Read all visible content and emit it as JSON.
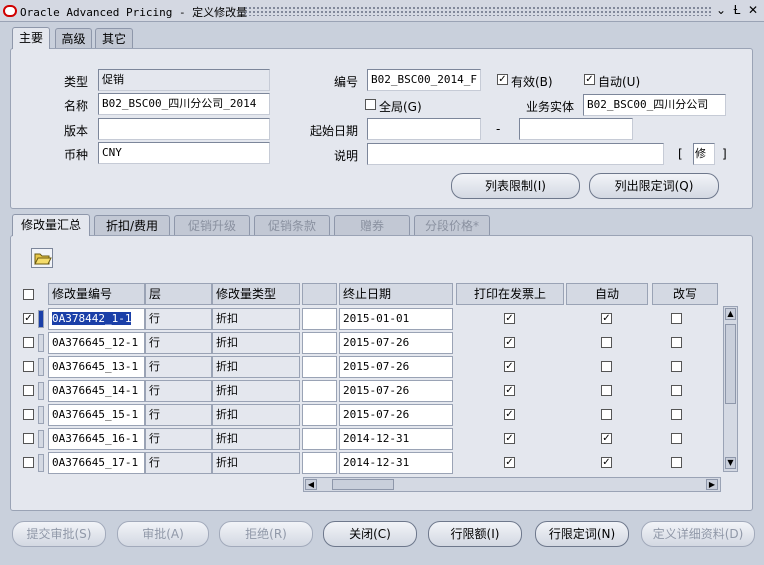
{
  "window": {
    "title": "Oracle Advanced Pricing - 定义修改量",
    "controls": [
      "⌄",
      "Ƚ",
      "✕"
    ]
  },
  "top_tabs": [
    {
      "label": "主要",
      "active": true
    },
    {
      "label": "高级",
      "active": false
    },
    {
      "label": "其它",
      "active": false
    }
  ],
  "header": {
    "type_label": "类型",
    "type_value": "促销",
    "name_label": "名称",
    "name_value": "B02_BSC00_四川分公司_2014",
    "version_label": "版本",
    "version_value": "",
    "currency_label": "币种",
    "currency_value": "CNY",
    "number_label": "编号",
    "number_value": "B02_BSC00_2014_F",
    "active_label": "有效(B)",
    "active_checked": true,
    "auto_label": "自动(U)",
    "auto_checked": true,
    "global_label": "全局(G)",
    "global_checked": false,
    "bu_label": "业务实体",
    "bu_value": "B02_BSC00_四川分公司",
    "start_label": "起始日期",
    "start_value": "",
    "end_value": "",
    "dash": "-",
    "desc_label": "说明",
    "desc_value": "",
    "bracket_open": "[",
    "bracket_close": "]",
    "flex_value": "修",
    "list_limit_btn": "列表限制(I)",
    "list_qualifier_btn": "列出限定词(Q)"
  },
  "sub_tabs": [
    {
      "label": "修改量汇总",
      "active": true,
      "enabled": true
    },
    {
      "label": "折扣/费用",
      "active": false,
      "enabled": true
    },
    {
      "label": "促销升级",
      "active": false,
      "enabled": false
    },
    {
      "label": "促销条款",
      "active": false,
      "enabled": false
    },
    {
      "label": "赠券",
      "active": false,
      "enabled": false
    },
    {
      "label": "分段价格*",
      "active": false,
      "enabled": false
    }
  ],
  "grid": {
    "headers": [
      "修改量编号",
      "层",
      "修改量类型",
      "",
      "终止日期",
      "打印在发票上",
      "自动",
      "改写"
    ],
    "rows": [
      {
        "selected": true,
        "checked": true,
        "number": "0A378442_1-1",
        "level": "行",
        "type": "折扣",
        "end_date": "2015-01-01",
        "print": true,
        "auto": true,
        "override": false
      },
      {
        "selected": false,
        "checked": false,
        "number": "0A376645_12-1",
        "level": "行",
        "type": "折扣",
        "end_date": "2015-07-26",
        "print": true,
        "auto": false,
        "override": false
      },
      {
        "selected": false,
        "checked": false,
        "number": "0A376645_13-1",
        "level": "行",
        "type": "折扣",
        "end_date": "2015-07-26",
        "print": true,
        "auto": false,
        "override": false
      },
      {
        "selected": false,
        "checked": false,
        "number": "0A376645_14-1",
        "level": "行",
        "type": "折扣",
        "end_date": "2015-07-26",
        "print": true,
        "auto": false,
        "override": false
      },
      {
        "selected": false,
        "checked": false,
        "number": "0A376645_15-1",
        "level": "行",
        "type": "折扣",
        "end_date": "2015-07-26",
        "print": true,
        "auto": false,
        "override": false
      },
      {
        "selected": false,
        "checked": false,
        "number": "0A376645_16-1",
        "level": "行",
        "type": "折扣",
        "end_date": "2014-12-31",
        "print": true,
        "auto": true,
        "override": false
      },
      {
        "selected": false,
        "checked": false,
        "number": "0A376645_17-1",
        "level": "行",
        "type": "折扣",
        "end_date": "2014-12-31",
        "print": true,
        "auto": true,
        "override": false
      }
    ]
  },
  "bottom_buttons": [
    {
      "label": "提交审批(S)",
      "enabled": false
    },
    {
      "label": "审批(A)",
      "enabled": false
    },
    {
      "label": "拒绝(R)",
      "enabled": false
    },
    {
      "label": "关闭(C)",
      "enabled": true
    },
    {
      "label": "行限额(I)",
      "enabled": true
    },
    {
      "label": "行限定词(N)",
      "enabled": true
    },
    {
      "label": "定义详细资料(D)",
      "enabled": false
    }
  ],
  "colors": {
    "selection": "#1a3fa8",
    "panel": "#e4e7ee",
    "background": "#c9d0dc",
    "logo": "#d00000"
  }
}
